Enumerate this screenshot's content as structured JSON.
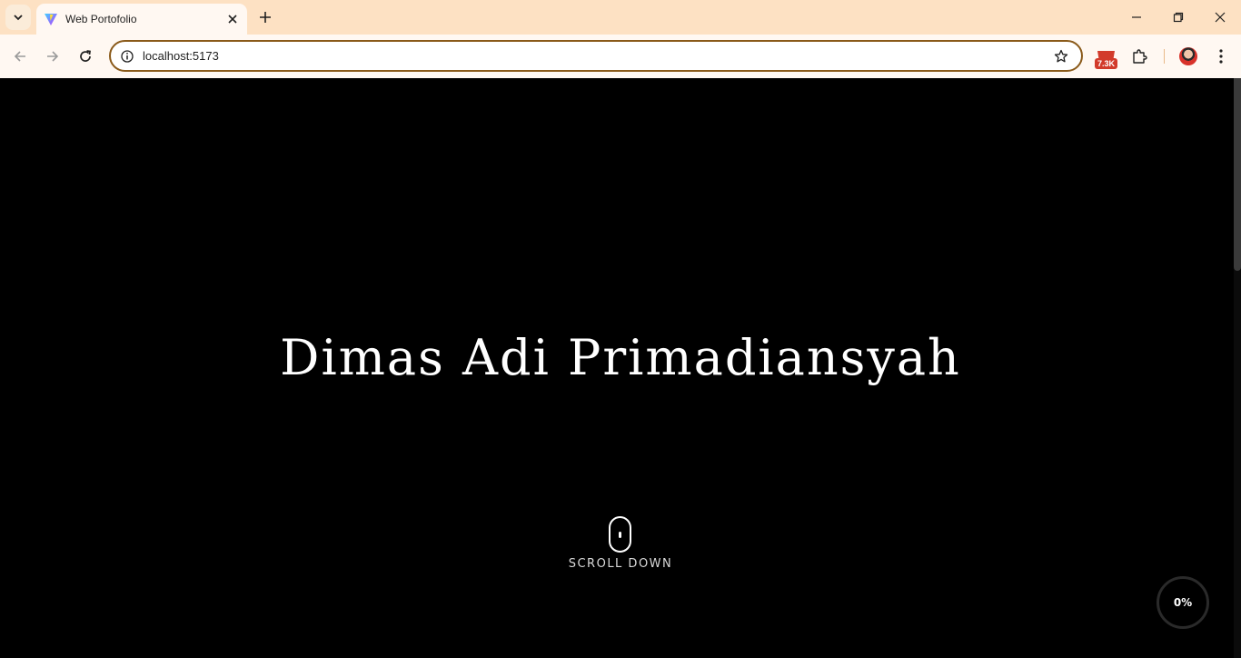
{
  "browser": {
    "tab_title": "Web Portofolio",
    "url": "localhost:5173",
    "extension_badge": "7.3K"
  },
  "page": {
    "hero_name": "Dimas Adi Primadiansyah",
    "scroll_label": "SCROLL DOWN",
    "progress_label": "0%",
    "progress_value": 0
  },
  "icons": {
    "tab_search": "chevron-down-icon",
    "favicon": "vite-logo-icon",
    "tab_close": "close-icon",
    "new_tab": "plus-icon",
    "back": "arrow-left-icon",
    "forward": "arrow-right-icon",
    "reload": "reload-icon",
    "site_info": "info-icon",
    "bookmark": "star-icon",
    "extensions": "puzzle-icon",
    "menu": "kebab-menu-icon"
  },
  "colors": {
    "tabbar_bg": "#fde1c3",
    "toolbar_bg": "#fff8f2",
    "omnibox_border": "#8a5a1a",
    "page_bg": "#000000",
    "text": "#ffffff"
  }
}
